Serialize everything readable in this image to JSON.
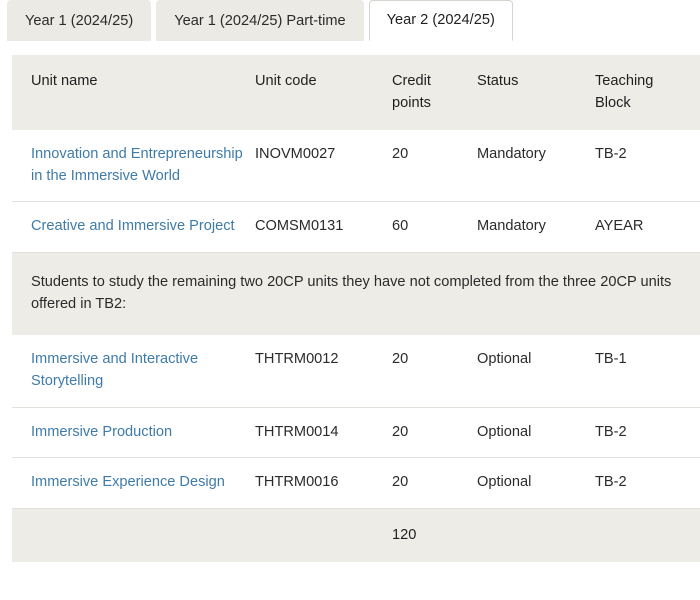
{
  "tabs": [
    {
      "label": "Year 1 (2024/25)",
      "active": false
    },
    {
      "label": "Year 1 (2024/25) Part-time",
      "active": false
    },
    {
      "label": "Year 2 (2024/25)",
      "active": true
    }
  ],
  "table": {
    "columns": [
      {
        "key": "unit_name",
        "label": "Unit name"
      },
      {
        "key": "unit_code",
        "label": "Unit code"
      },
      {
        "key": "credit_points",
        "label": "Credit points"
      },
      {
        "key": "status",
        "label": "Status"
      },
      {
        "key": "teaching_block",
        "label": "Teaching Block"
      }
    ],
    "rows": [
      {
        "type": "unit",
        "unit_name": "Innovation and Entrepreneurship in the Immersive World",
        "unit_code": "INOVM0027",
        "credit_points": "20",
        "status": "Mandatory",
        "teaching_block": "TB-2"
      },
      {
        "type": "unit",
        "unit_name": "Creative and Immersive Project",
        "unit_code": "COMSM0131",
        "credit_points": "60",
        "status": "Mandatory",
        "teaching_block": "AYEAR"
      },
      {
        "type": "note",
        "text": "Students to study the remaining two 20CP units they have not completed from the three 20CP units offered in TB2:"
      },
      {
        "type": "unit",
        "unit_name": "Immersive and Interactive Storytelling",
        "unit_code": "THTRM0012",
        "credit_points": "20",
        "status": "Optional",
        "teaching_block": "TB-1"
      },
      {
        "type": "unit",
        "unit_name": "Immersive Production",
        "unit_code": "THTRM0014",
        "credit_points": "20",
        "status": "Optional",
        "teaching_block": "TB-2"
      },
      {
        "type": "unit",
        "unit_name": "Immersive Experience Design",
        "unit_code": "THTRM0016",
        "credit_points": "20",
        "status": "Optional",
        "teaching_block": "TB-2"
      }
    ],
    "footer": {
      "unit_name": "",
      "unit_code": "",
      "credit_points_total": "120",
      "status": "",
      "teaching_block": ""
    }
  },
  "colors": {
    "link": "#3f7ba9",
    "header_background": "#eeece7",
    "tab_inactive_background": "#eceae5",
    "tab_active_background": "#ffffff",
    "row_divider": "#e2e0db",
    "text": "#2b2b2b"
  }
}
